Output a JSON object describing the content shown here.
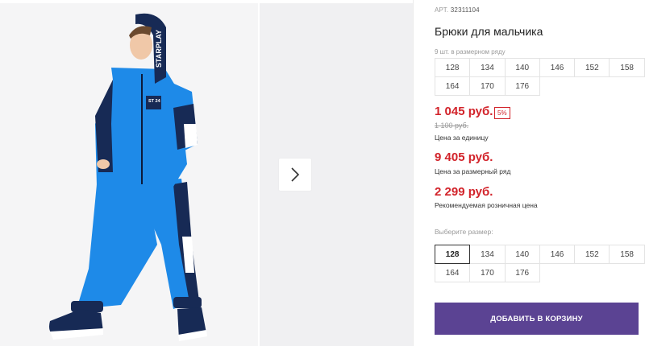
{
  "product": {
    "article_label": "АРТ.",
    "article": "32311104",
    "title": "Брюки для мальчика",
    "hood_text": "STARPLAY",
    "patch_text": "ST 24"
  },
  "series": {
    "label": "9 шт. в размерном ряду",
    "sizes": [
      "128",
      "134",
      "140",
      "146",
      "152",
      "158",
      "164",
      "170",
      "176"
    ]
  },
  "pricing": {
    "price": "1 045 руб.",
    "discount": "5%",
    "old_price": "1 100 руб.",
    "unit_caption": "Цена за единицу",
    "series_price": "9 405 руб.",
    "series_caption": "Цена за размерный ряд",
    "rrp": "2 299 руб.",
    "rrp_caption": "Рекомендуемая розничная цена"
  },
  "size_select": {
    "label": "Выберите размер:",
    "selected": "128",
    "sizes": [
      "128",
      "134",
      "140",
      "146",
      "152",
      "158",
      "164",
      "170",
      "176"
    ]
  },
  "cart_button": "ДОБАВИТЬ В КОРЗИНУ",
  "colors": {
    "accent_price": "#d2232a",
    "button": "#5b4393",
    "jacket": "#1e8ae8",
    "navy": "#172a55"
  },
  "icons": {
    "next_arrow": "chevron-right-icon"
  }
}
